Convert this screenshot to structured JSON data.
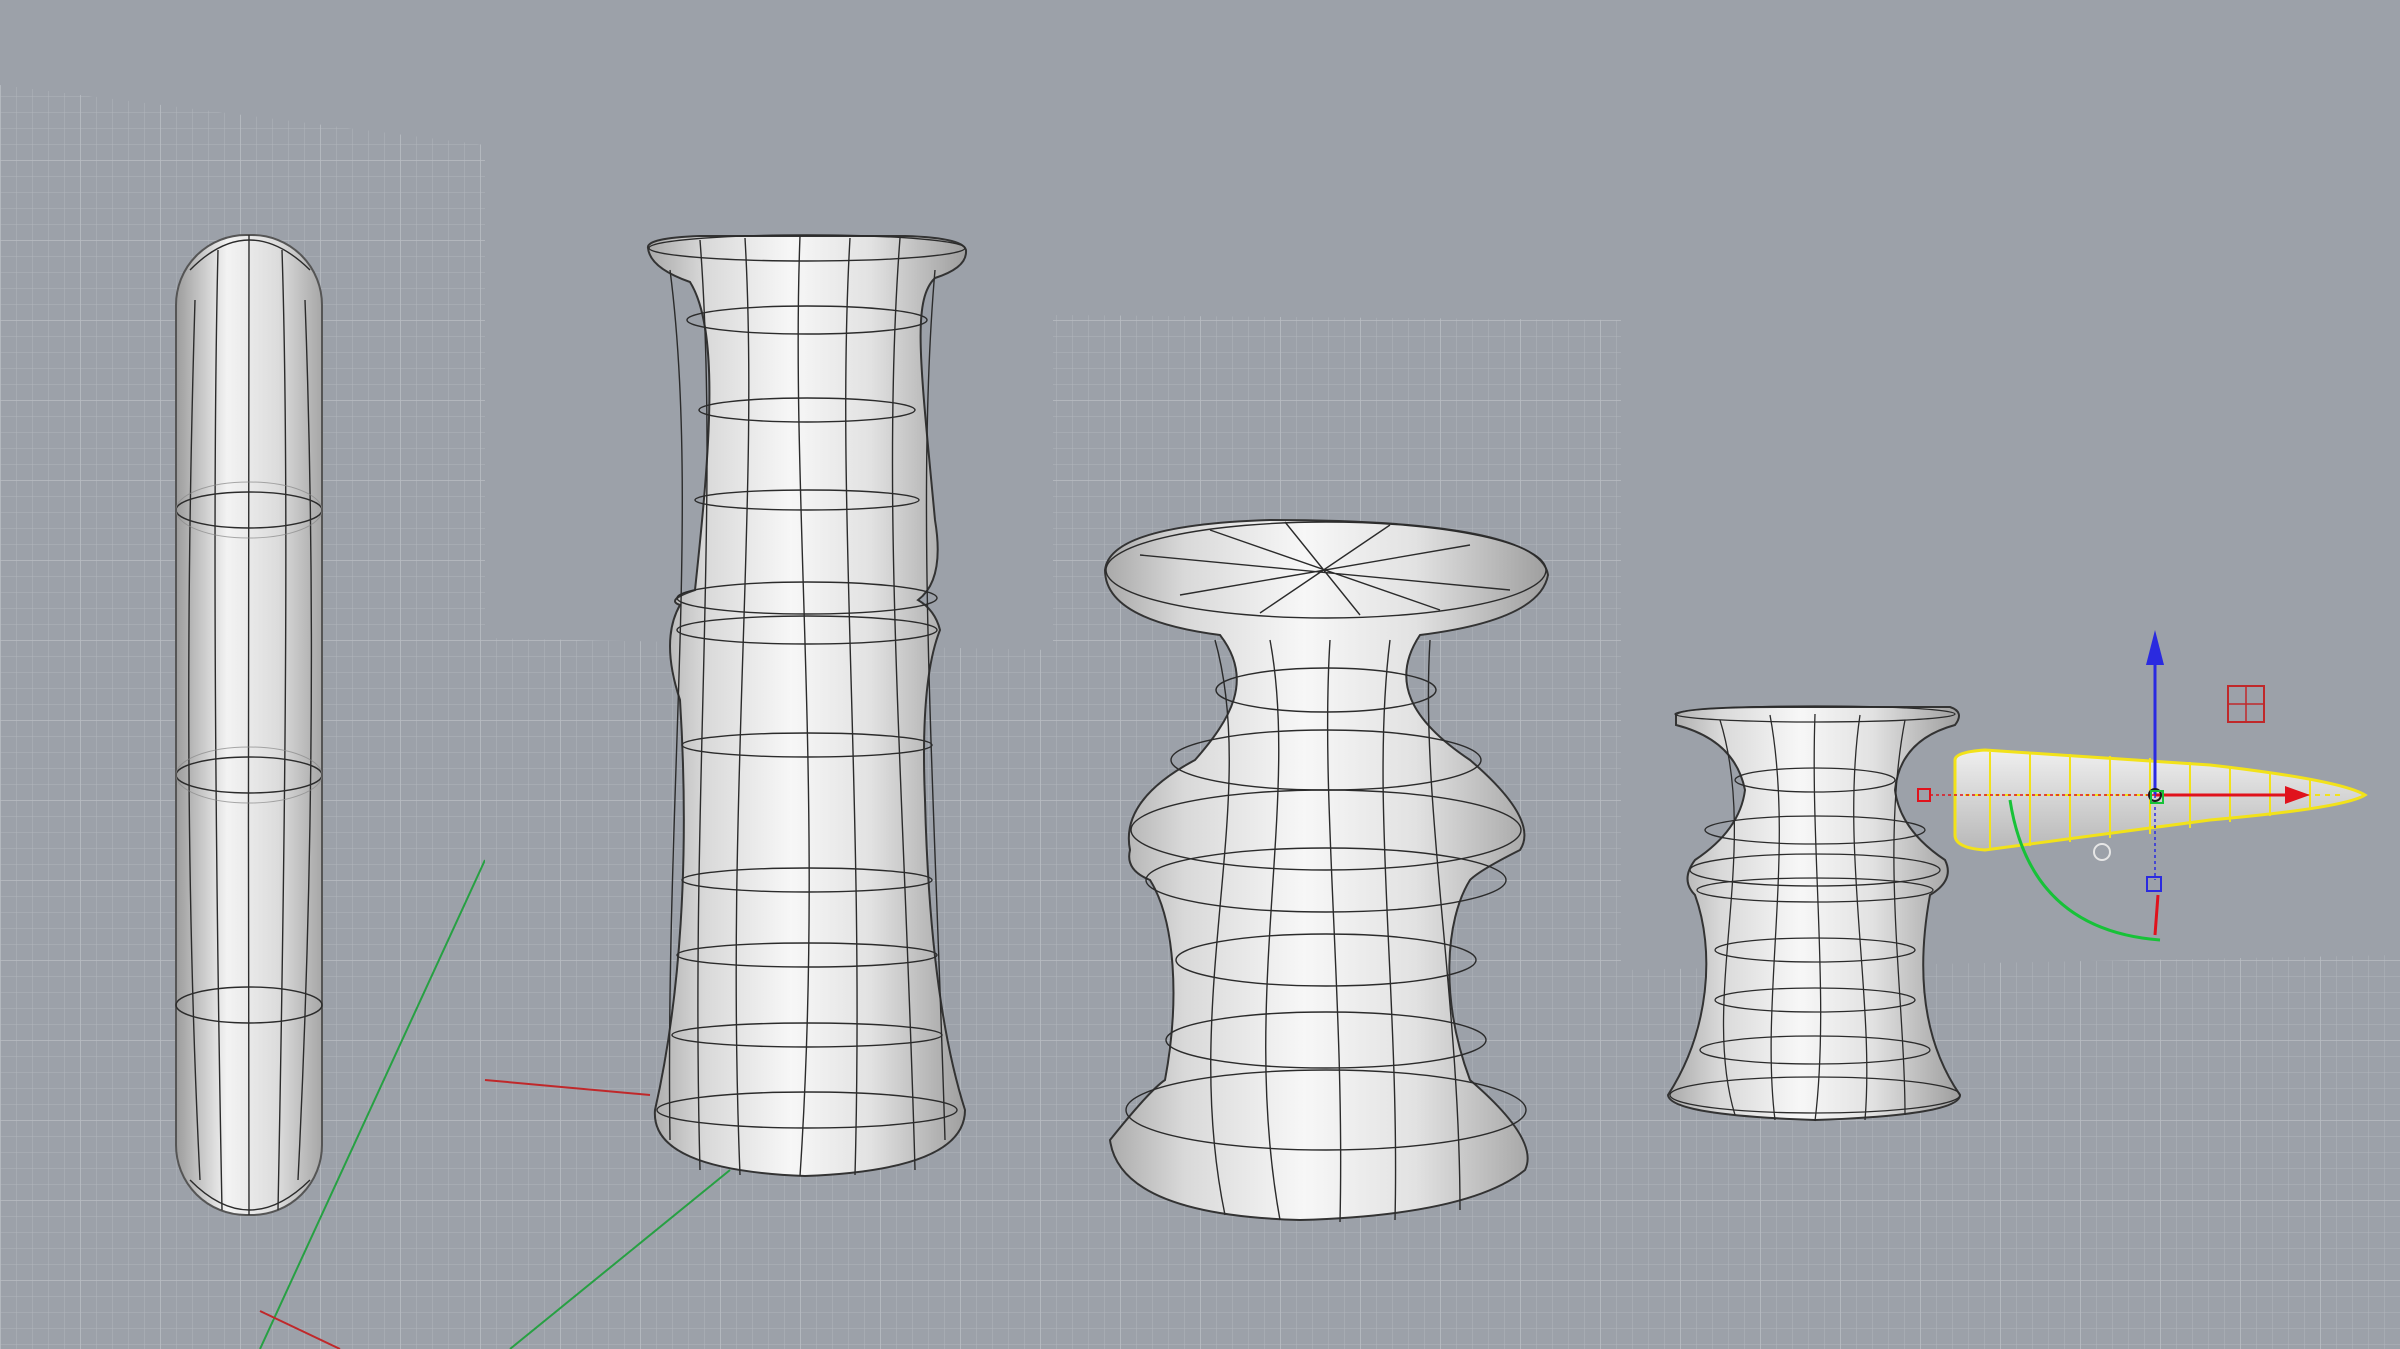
{
  "app": {
    "kind": "3D modeling viewport collage"
  },
  "viewports": [
    {
      "name": "viewport-1",
      "object": "capsule-rod"
    },
    {
      "name": "viewport-2",
      "object": "tall-flared-column"
    },
    {
      "name": "viewport-3",
      "object": "stool-shaped-revolve"
    },
    {
      "name": "viewport-4",
      "object": "short-column-with-gumball"
    }
  ],
  "colors": {
    "background": "#9ca1a9",
    "grid_line": "#aeb3ba",
    "grid_fill": "#a4a9b0",
    "x_axis": "#c0282a",
    "y_axis": "#27a043",
    "z_axis": "#2a2ae0",
    "selection_highlight": "#f2e21a",
    "surface_light": "#f4f4f4",
    "surface_mid": "#d2d2d2",
    "isocurve": "#2b2b2b"
  },
  "icons": {
    "gumball": "gumball-manipulator-icon",
    "scale_handle": "scale-handle-icon",
    "rotate_arc": "rotate-arc-icon"
  }
}
